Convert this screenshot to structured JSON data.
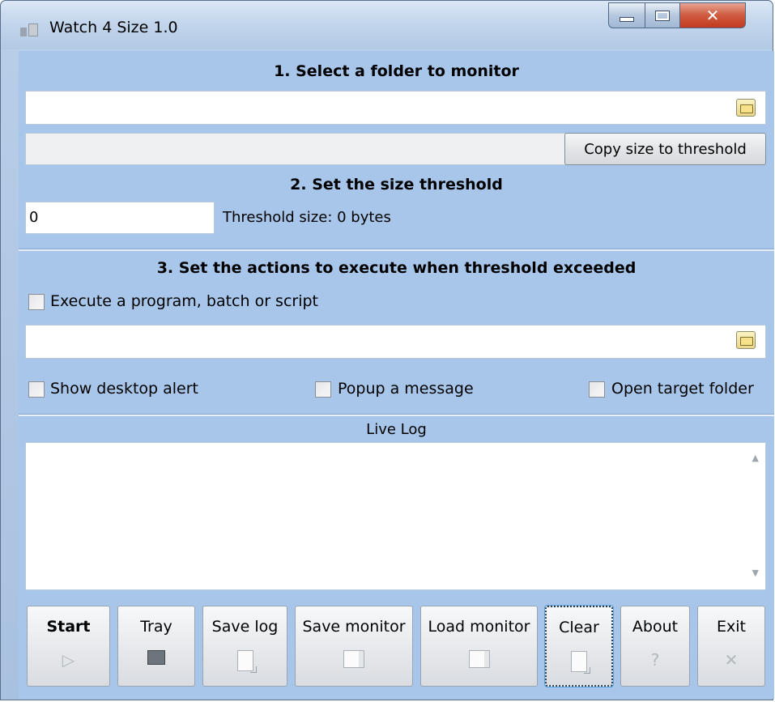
{
  "window": {
    "title": "Watch 4 Size 1.0"
  },
  "section1": {
    "title": "1. Select a folder to monitor",
    "folder_value": "",
    "size_value": "",
    "copy_button": "Copy size to threshold"
  },
  "section2": {
    "title": "2. Set the size threshold",
    "threshold_value": "0",
    "threshold_info": "Threshold size: 0 bytes"
  },
  "section3": {
    "title": "3. Set the actions to execute when threshold exceeded",
    "execute_label": "Execute a program, batch or script",
    "program_value": "",
    "desktop_alert": "Show desktop alert",
    "popup_message": "Popup a message",
    "open_folder": "Open target folder"
  },
  "log": {
    "title": "Live Log"
  },
  "toolbar": {
    "start": "Start",
    "tray": "Tray",
    "save_log": "Save log",
    "save_monitor": "Save monitor",
    "load_monitor": "Load monitor",
    "clear": "Clear",
    "about": "About",
    "exit": "Exit"
  }
}
